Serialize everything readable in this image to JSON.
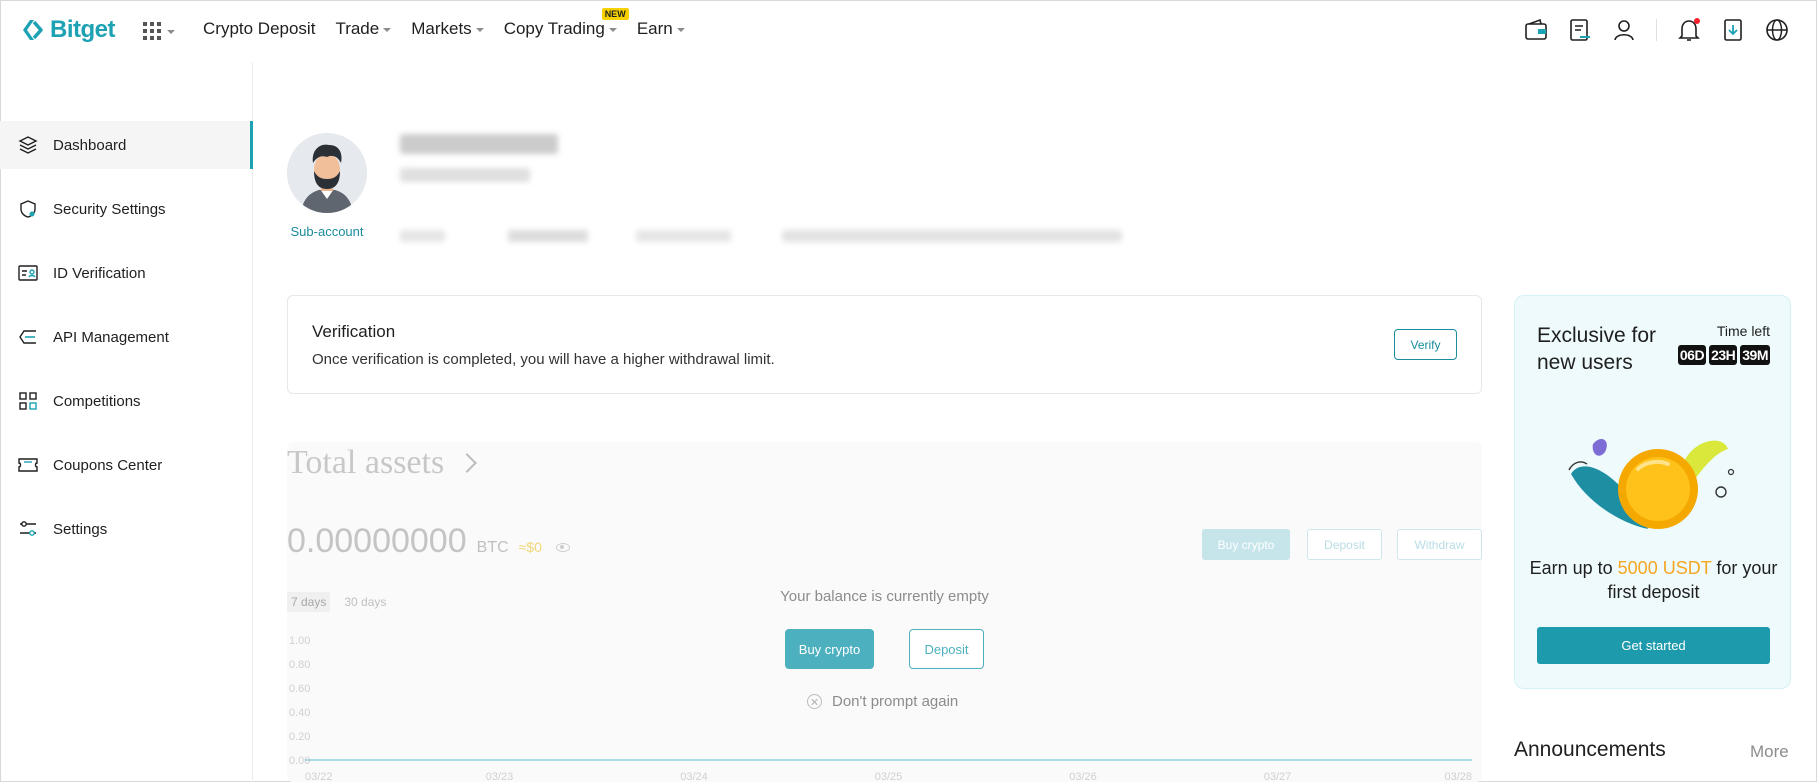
{
  "header": {
    "logo_text": "Bitget",
    "nav": [
      {
        "label": "Crypto Deposit",
        "caret": false
      },
      {
        "label": "Trade",
        "caret": true
      },
      {
        "label": "Markets",
        "caret": true
      },
      {
        "label": "Copy Trading",
        "caret": true,
        "badge": "NEW"
      },
      {
        "label": "Earn",
        "caret": true
      }
    ],
    "icons": [
      "wallet-icon",
      "orders-icon",
      "user-icon",
      "bell-icon",
      "download-icon",
      "globe-icon"
    ]
  },
  "sidebar": {
    "items": [
      {
        "label": "Dashboard",
        "icon": "layers-icon",
        "active": true
      },
      {
        "label": "Security Settings",
        "icon": "shield-icon",
        "active": false
      },
      {
        "label": "ID Verification",
        "icon": "id-card-icon",
        "active": false
      },
      {
        "label": "API Management",
        "icon": "api-icon",
        "active": false
      },
      {
        "label": "Competitions",
        "icon": "grid-icon",
        "active": false
      },
      {
        "label": "Coupons Center",
        "icon": "coupon-icon",
        "active": false
      },
      {
        "label": "Settings",
        "icon": "sliders-icon",
        "active": false
      }
    ]
  },
  "profile": {
    "account_type": "Sub-account"
  },
  "verification": {
    "title": "Verification",
    "description": "Once verification is completed, you will have a higher withdrawal limit.",
    "button": "Verify"
  },
  "assets": {
    "title": "Total assets",
    "balance": "0.00000000",
    "unit": "BTC",
    "approx": "≈$0",
    "buttons": {
      "buy": "Buy crypto",
      "deposit": "Deposit",
      "withdraw": "Withdraw"
    },
    "ranges": [
      "7 days",
      "30 days"
    ],
    "empty_message": "Your balance is currently empty",
    "empty_buy": "Buy crypto",
    "empty_deposit": "Deposit",
    "dont_prompt": "Don't prompt again"
  },
  "chart_data": {
    "type": "line",
    "x": [
      "03/22",
      "03/23",
      "03/24",
      "03/25",
      "03/26",
      "03/27",
      "03/28"
    ],
    "series": [
      {
        "values": [
          0,
          0,
          0,
          0,
          0,
          0,
          0
        ]
      }
    ],
    "ytick_labels": [
      "1.00",
      "0.80",
      "0.60",
      "0.40",
      "0.20",
      "0.00"
    ],
    "ylim": [
      0,
      1
    ],
    "grid": false
  },
  "promo": {
    "title": "Exclusive for new users",
    "time_left_label": "Time left",
    "timer": [
      "06D",
      "23H",
      "39M"
    ],
    "text_before": "Earn up to ",
    "highlight": "5000 USDT",
    "text_after": " for your first deposit",
    "button": "Get started",
    "colors": {
      "highlight": "#f5a623",
      "button": "#1e9aad"
    }
  },
  "announcements": {
    "title": "Announcements",
    "more": "More"
  },
  "colors": {
    "brand": "#1da2b4"
  }
}
